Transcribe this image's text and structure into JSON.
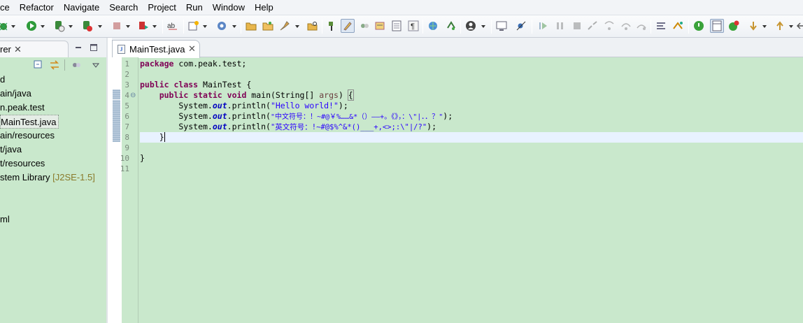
{
  "menu": [
    "ce",
    "Refactor",
    "Navigate",
    "Search",
    "Project",
    "Run",
    "Window",
    "Help"
  ],
  "left_panel": {
    "tab_label": "rer",
    "tree": [
      {
        "label": "d"
      },
      {
        "label": "ain/java"
      },
      {
        "label": "n.peak.test"
      },
      {
        "label": "MainTest.java",
        "selected": true
      },
      {
        "label": "ain/resources"
      },
      {
        "label": "t/java"
      },
      {
        "label": "t/resources"
      },
      {
        "label": "stem Library",
        "tag": "[J2SE-1.5]"
      },
      {
        "label": "ml"
      }
    ]
  },
  "editor": {
    "tab_label": "MainTest.java",
    "line_numbers": [
      "1",
      "2",
      "3",
      "4",
      "5",
      "6",
      "7",
      "8",
      "9",
      "10",
      "11"
    ],
    "lines": {
      "l1_kw": "package",
      "l1_rest": " com.peak.test;",
      "l3_kw1": "public",
      "l3_kw2": "class",
      "l3_rest": " MainTest {",
      "l4_indent": "    ",
      "l4_kw1": "public",
      "l4_kw2": "static",
      "l4_kw3": "void",
      "l4_rest": " main(String[] ",
      "l4_param": "args",
      "l4_close": ") ",
      "l4_brace": "{",
      "l5_pre": "        System.",
      "l5_field": "out",
      "l5_mid": ".println(",
      "l5_str": "\"Hello world!\"",
      "l5_end": ");",
      "l6_pre": "        System.",
      "l6_field": "out",
      "l6_mid": ".println(",
      "l6_str": "\"中文符号：！~#@￥%……&*（）——+。《》，：\\\"|．．？\"",
      "l6_end": ");",
      "l7_pre": "        System.",
      "l7_field": "out",
      "l7_mid": ".println(",
      "l7_str": "\"英文符号：!~#@$%^&*()___+,<>;:\\\"|/?\"",
      "l7_end": ");",
      "l8": "    }",
      "l10": "}"
    }
  }
}
